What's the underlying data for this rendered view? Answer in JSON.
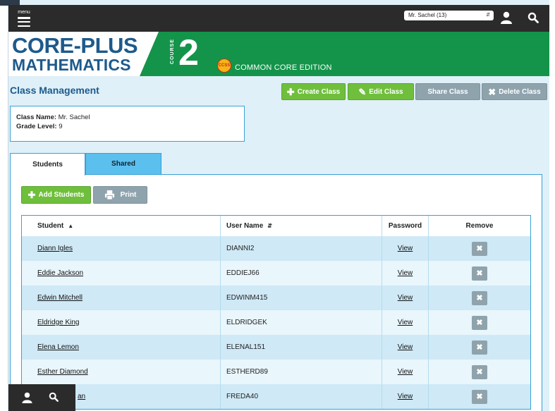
{
  "topbar": {
    "menu_label": "menu",
    "class_selector": "Mr. Sachel (13)"
  },
  "brand": {
    "title_line1": "CORE-PLUS",
    "title_line2": "MATHEMATICS",
    "course_label": "COURSE",
    "course_number": "2",
    "badge": "CCSS",
    "edition": "COMMON CORE EDITION",
    "colors": {
      "brand_blue": "#1d5a8c",
      "brand_green": "#13944a"
    }
  },
  "page": {
    "title": "Class Management",
    "actions": {
      "create": "Create Class",
      "edit": "Edit Class",
      "share": "Share Class",
      "delete": "Delete Class"
    }
  },
  "class_info": {
    "name_label": "Class Name:",
    "name_value": "Mr. Sachel",
    "grade_label": "Grade Level:",
    "grade_value": "9"
  },
  "tabs": {
    "students": "Students",
    "shared": "Shared"
  },
  "toolbar": {
    "add_students": "Add Students",
    "print": "Print"
  },
  "table": {
    "headers": {
      "student": "Student",
      "username": "User Name",
      "password": "Password",
      "remove": "Remove"
    },
    "rows": [
      {
        "student": "Diann Igles",
        "username": "DIANNI2",
        "password": "View"
      },
      {
        "student": "Eddie Jackson",
        "username": "EDDIEJ66",
        "password": "View"
      },
      {
        "student": "Edwin Mitchell",
        "username": "EDWINM415",
        "password": "View"
      },
      {
        "student": "Eldridge King",
        "username": "ELDRIDGEK",
        "password": "View"
      },
      {
        "student": "Elena Lemon",
        "username": "ELENAL151",
        "password": "View"
      },
      {
        "student": "Esther Diamond",
        "username": "ESTHERD89",
        "password": "View"
      },
      {
        "student": "an",
        "username": "FREDA40",
        "password": "View"
      }
    ]
  }
}
